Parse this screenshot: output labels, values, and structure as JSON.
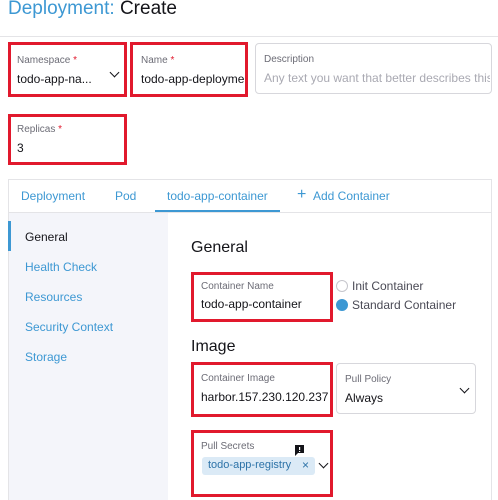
{
  "page": {
    "title_link": "Deployment:",
    "title_rest": "Create"
  },
  "fields": {
    "namespace": {
      "label": "Namespace",
      "required": "*",
      "value": "todo-app-na..."
    },
    "name": {
      "label": "Name",
      "required": "*",
      "value": "todo-app-deployme"
    },
    "description": {
      "label": "Description",
      "placeholder": "Any text you want that better describes this"
    },
    "replicas": {
      "label": "Replicas",
      "required": "*",
      "value": "3"
    }
  },
  "tabs": [
    {
      "label": "Deployment"
    },
    {
      "label": "Pod"
    },
    {
      "label": "todo-app-container",
      "active": true
    },
    {
      "label": "Add Container",
      "icon": "plus-icon"
    }
  ],
  "sidebar": {
    "items": [
      {
        "label": "General",
        "active": true
      },
      {
        "label": "Health Check"
      },
      {
        "label": "Resources"
      },
      {
        "label": "Security Context"
      },
      {
        "label": "Storage"
      }
    ]
  },
  "general": {
    "heading": "General",
    "container_name": {
      "label": "Container Name",
      "value": "todo-app-container"
    },
    "container_type": {
      "options": [
        {
          "label": "Init Container",
          "selected": false
        },
        {
          "label": "Standard Container",
          "selected": true
        }
      ]
    }
  },
  "image": {
    "heading": "Image",
    "container_image": {
      "label": "Container Image",
      "value": "harbor.157.230.120.237"
    },
    "pull_policy": {
      "label": "Pull Policy",
      "value": "Always"
    },
    "pull_secrets": {
      "label": "Pull Secrets",
      "chip": "todo-app-registry",
      "chip_remove": "×"
    }
  },
  "colors": {
    "accent": "#3d98d3",
    "highlight": "#e1192d",
    "text": "#141419",
    "muted": "#6c6c76",
    "nav_bg": "#f4f5fa",
    "chip_bg": "#dbeaf6"
  }
}
